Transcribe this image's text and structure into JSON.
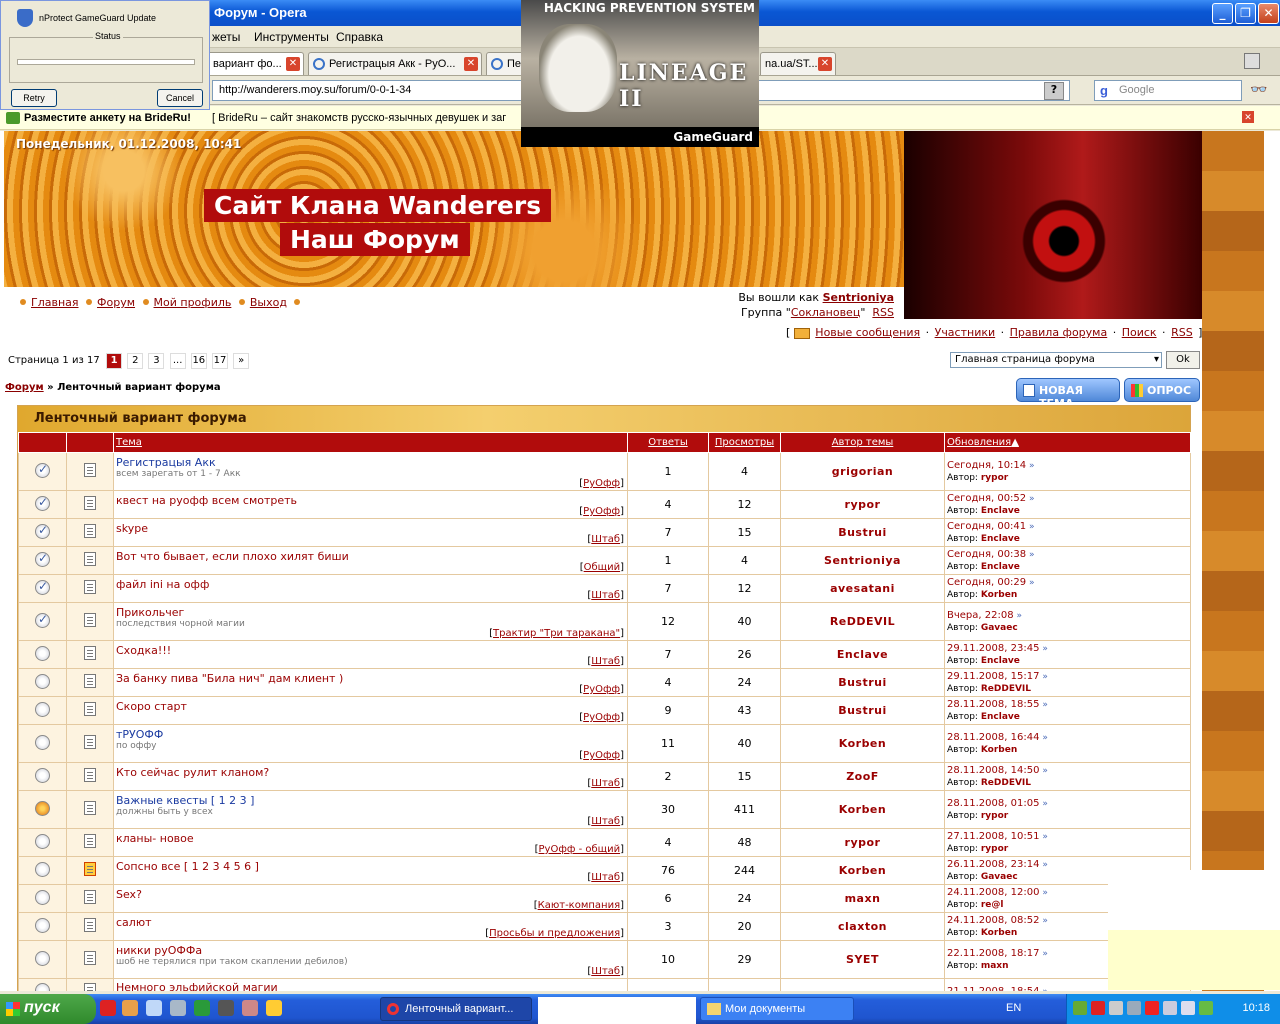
{
  "window": {
    "title": "Форум - Opera"
  },
  "menu": [
    "жеты",
    "Инструменты",
    "Справка"
  ],
  "tabs": [
    {
      "label": "вариант фо...",
      "active": true
    },
    {
      "label": "Регистрацыя Акк - РуО..."
    },
    {
      "label": "Пер"
    },
    {
      "label": "na.ua/ST..."
    }
  ],
  "address": "http://wanderers.moy.su/forum/0-0-1-34",
  "search_placeholder": "Google",
  "adbar": {
    "ad1": "Разместите анкету на BrideRu!",
    "ad2": "[ BrideRu – сайт знакомств русско-язычных девушек и заг"
  },
  "gameguard": {
    "title": "nProtect GameGuard Update",
    "status_label": "Status",
    "retry": "Retry",
    "cancel": "Cancel",
    "banner_header": "HACKING PREVENTION SYSTEM",
    "banner_logo": "LINEAGE II",
    "banner_footer": "GameGuard"
  },
  "site": {
    "date": "Понедельник, 01.12.2008, 10:41",
    "title_line1": "Сайт Клана Wanderers",
    "title_line2": "Наш Форум",
    "nav": [
      "Главная",
      "Форум",
      "Мой профиль",
      "Выход"
    ],
    "logged_as": "Вы вошли как",
    "user": "Sentrioniya",
    "group_label": "Группа",
    "group": "Сокланoвец",
    "rss": "RSS",
    "toplinks": [
      "Новые сообщения",
      "Участники",
      "Правила форума",
      "Поиск",
      "RSS"
    ]
  },
  "pager": {
    "label": "Страница 1 из 17",
    "pages": [
      "1",
      "2",
      "3",
      "...",
      "16",
      "17",
      "»"
    ]
  },
  "forum_select": "Главная страница форума",
  "ok": "Ok",
  "breadcrumb": {
    "root": "Форум",
    "sep": "»",
    "current": "Ленточный вариант форума"
  },
  "buttons": {
    "new_topic": "НОВАЯ ТЕМА",
    "poll": "ОПРОС"
  },
  "forum": {
    "title": "Ленточный вариант форума",
    "columns": [
      "Тема",
      "Ответы",
      "Просмотры",
      "Автор темы",
      "Обновления"
    ],
    "topics": [
      {
        "title": "Регистрацыя Акк",
        "desc": "всем зарегать от 1 - 7 Акк",
        "section": "РуОфф",
        "replies": "1",
        "views": "4",
        "author": "grigorian",
        "last_date": "Сегодня, 10:14",
        "last_author": "rypor",
        "read": true,
        "blue": true
      },
      {
        "title": "квест на руофф всем смотреть",
        "desc": "",
        "section": "РуОфф",
        "replies": "4",
        "views": "12",
        "author": "rypor",
        "last_date": "Сегодня, 00:52",
        "last_author": "Enclave",
        "read": true
      },
      {
        "title": "skype",
        "desc": "",
        "section": "Штаб",
        "replies": "7",
        "views": "15",
        "author": "Bustrui",
        "last_date": "Сегодня, 00:41",
        "last_author": "Enclave",
        "read": true
      },
      {
        "title": "Вот что бывает, если плохо хилят биши",
        "desc": "",
        "section": "Общий",
        "replies": "1",
        "views": "4",
        "author": "Sentrioniya",
        "last_date": "Сегодня, 00:38",
        "last_author": "Enclave",
        "read": true
      },
      {
        "title": "файл ini на офф",
        "desc": "",
        "section": "Штаб",
        "replies": "7",
        "views": "12",
        "author": "avesatani",
        "last_date": "Сегодня, 00:29",
        "last_author": "Korben",
        "read": true
      },
      {
        "title": "Прикольчег",
        "desc": "последствия чорной магии",
        "section": "Трактир \"Три таракана\"",
        "replies": "12",
        "views": "40",
        "author": "ReDDEVIL",
        "last_date": "Вчера, 22:08",
        "last_author": "Gavaec",
        "read": true
      },
      {
        "title": "Сходка!!!",
        "desc": "",
        "section": "Штаб",
        "replies": "7",
        "views": "26",
        "author": "Enclave",
        "last_date": "29.11.2008, 23:45",
        "last_author": "Enclave"
      },
      {
        "title": "За банку пива \"Била нич\" дам клиент )",
        "desc": "",
        "section": "РуОфф",
        "replies": "4",
        "views": "24",
        "author": "Bustrui",
        "last_date": "29.11.2008, 15:17",
        "last_author": "ReDDEVIL"
      },
      {
        "title": "Скоро старт",
        "desc": "",
        "section": "РуОфф",
        "replies": "9",
        "views": "43",
        "author": "Bustrui",
        "last_date": "28.11.2008, 18:55",
        "last_author": "Enclave"
      },
      {
        "title": "тРУОФФ",
        "desc": "по оффу",
        "section": "РуОфф",
        "replies": "11",
        "views": "40",
        "author": "Korben",
        "last_date": "28.11.2008, 16:44",
        "last_author": "Korben",
        "blue": true
      },
      {
        "title": "Кто сейчас рулит кланом?",
        "desc": "",
        "section": "Штаб",
        "replies": "2",
        "views": "15",
        "author": "ZooF",
        "last_date": "28.11.2008, 14:50",
        "last_author": "ReDDEVIL"
      },
      {
        "title": "Важные квесты [ 1 2 3 ]",
        "desc": "должны быть у всех",
        "section": "Штаб",
        "replies": "30",
        "views": "411",
        "author": "Korben",
        "last_date": "28.11.2008, 01:05",
        "last_author": "rypor",
        "hot": true,
        "blue": true
      },
      {
        "title": "кланы- новое",
        "desc": "",
        "section": "РуОфф - общий",
        "replies": "4",
        "views": "48",
        "author": "rypor",
        "last_date": "27.11.2008, 10:51",
        "last_author": "rypor"
      },
      {
        "title": "Сопсно все [ 1 2 3 4 5 6 ]",
        "desc": "",
        "section": "Штаб",
        "replies": "76",
        "views": "244",
        "author": "Korben",
        "last_date": "26.11.2008, 23:14",
        "last_author": "Gavaec",
        "fire": true
      },
      {
        "title": "Sex?",
        "desc": "",
        "section": "Кают-компания",
        "replies": "6",
        "views": "24",
        "author": "maxn",
        "last_date": "24.11.2008, 12:00",
        "last_author": "re@l"
      },
      {
        "title": "салют",
        "desc": "",
        "section": "Просьбы и предложения",
        "replies": "3",
        "views": "20",
        "author": "claxton",
        "last_date": "24.11.2008, 08:52",
        "last_author": "Korben"
      },
      {
        "title": "никки руОФФа",
        "desc": "шоб не терялися при таком скаплении дебилов)",
        "section": "Штаб",
        "replies": "10",
        "views": "29",
        "author": "SYET",
        "last_date": "22.11.2008, 18:17",
        "last_author": "maxn"
      },
      {
        "title": "Немного эльфийской магии",
        "desc": "",
        "section": "",
        "replies": "",
        "views": "",
        "author": "",
        "last_date": "21.11.2008, 18:54",
        "last_author": ""
      }
    ],
    "last_author_prefix": "Автор:"
  },
  "taskbar": {
    "start": "пуск",
    "items": [
      {
        "label": "Ленточный вариант...",
        "active": true
      },
      {
        "label": ""
      },
      {
        "label": "Мои документы"
      }
    ],
    "lang": "EN",
    "clock": "10:18"
  },
  "colors": {
    "accent": "#b10c0c",
    "link": "#8a0000",
    "header_orange": "#e58a10"
  }
}
